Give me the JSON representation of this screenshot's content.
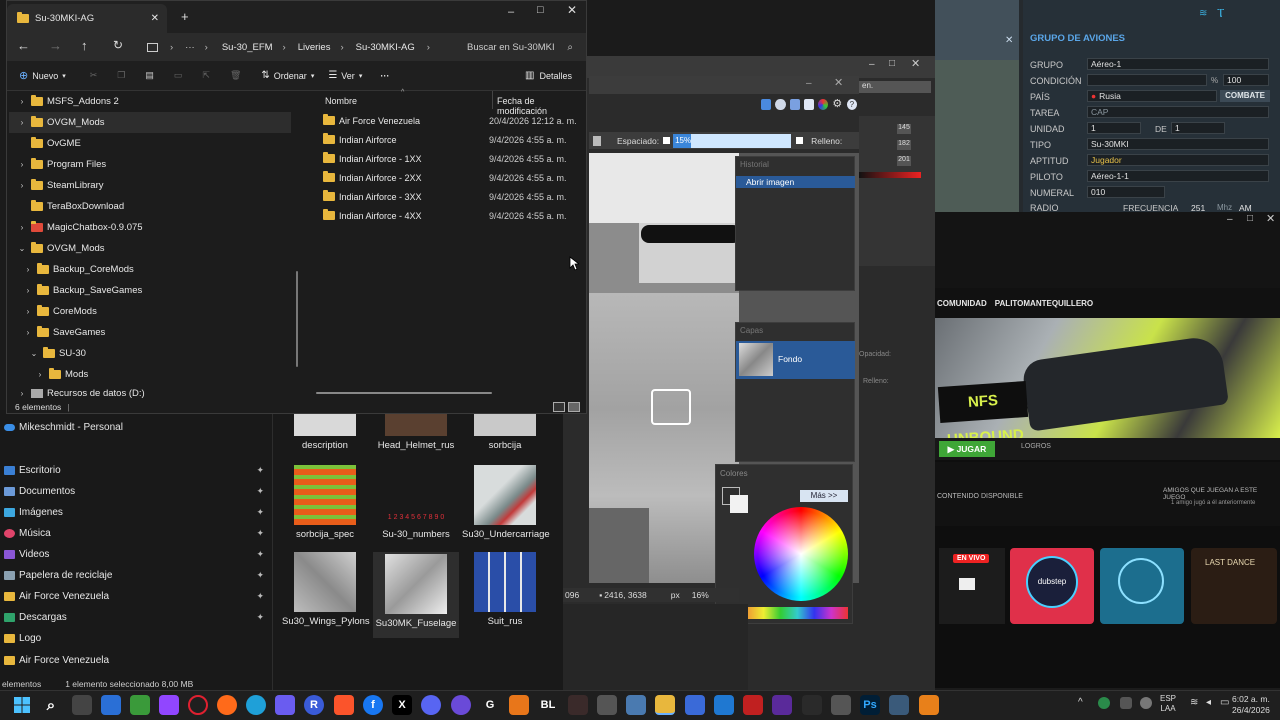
{
  "explorer": {
    "tab_title": "Su-30MKI-AG",
    "new_tab": "+",
    "breadcrumb": [
      "Su-30_EFM",
      "Liveries",
      "Su-30MKI-AG"
    ],
    "search_placeholder": "Buscar en Su-30MKI",
    "toolbar": {
      "new": "Nuevo",
      "sort": "Ordenar",
      "view": "Ver",
      "more": "···",
      "details": "Detalles"
    },
    "tree": [
      "MSFS_Addons 2",
      "OVGM_Mods",
      "OvGME",
      "Program Files",
      "SteamLibrary",
      "TeraBoxDownload",
      "MagicChatbox-0.9.075",
      "OVGM_Mods",
      "Backup_CoreMods",
      "Backup_SaveGames",
      "CoreMods",
      "SaveGames",
      "SU-30",
      "Mods",
      "Recursos de datos (D:)"
    ],
    "columns": {
      "name": "Nombre",
      "date": "Fecha de modificación"
    },
    "files": [
      {
        "name": "Air Force Venezuela",
        "date": "20/4/2026 12:12 a. m."
      },
      {
        "name": "Indian Airforce",
        "date": "9/4/2026 4:55 a. m."
      },
      {
        "name": "Indian Airforce - 1XX",
        "date": "9/4/2026 4:55 a. m."
      },
      {
        "name": "Indian Airforce - 2XX",
        "date": "9/4/2026 4:55 a. m."
      },
      {
        "name": "Indian Airforce - 3XX",
        "date": "9/4/2026 4:55 a. m."
      },
      {
        "name": "Indian Airforce - 4XX",
        "date": "9/4/2026 4:55 a. m."
      }
    ],
    "status": "6 elementos"
  },
  "bg_explorer": {
    "onedrive": "Mikeschmidt - Personal",
    "quick_access": [
      "Escritorio",
      "Documentos",
      "Imágenes",
      "Música",
      "Videos",
      "Papelera de reciclaje",
      "Air Force Venezuela",
      "Descargas",
      "Logo",
      "Air Force Venezuela"
    ],
    "thumbs": [
      "description",
      "Head_Helmet_rus",
      "sorbcija",
      "sorbcija_spec",
      "Su-30_numbers",
      "Su30_Undercarriage",
      "Su30_Wings_Pylons",
      "Su30MK_Fuselage",
      "Suit_rus"
    ],
    "numbers_text": "1 2 3 4 5 6 7 8 9 0",
    "status_left": "elementos",
    "status_sel": "1 elemento seleccionado  8,00 MB"
  },
  "ps": {
    "spacing_label": "Espaciado:",
    "spacing_value": "15%",
    "fill_label": "Relleno:",
    "history_title": "Historial",
    "history_item": "Abrir imagen",
    "layers_title": "Capas",
    "layer_name": "Fondo",
    "colors_title": "Colores",
    "more_btn": "Más >>",
    "coords": "2416, 3638",
    "unit": "px",
    "zoom": "16%",
    "left_num": "096",
    "rgb": [
      "145",
      "182",
      "201"
    ],
    "opacity_label": "Opacidad:",
    "fill2_label": "Relleno:",
    "mode_label": "en."
  },
  "editor": {
    "title": "GRUPO DE AVIONES",
    "grupo_label": "GRUPO",
    "grupo": "Aéreo-1",
    "condicion_label": "CONDICIÓN",
    "condicion_value": "100",
    "pais_label": "PAÍS",
    "pais": "Rusia",
    "combate": "COMBATE",
    "tarea_label": "TAREA",
    "tarea": "CAP",
    "unidad_label": "UNIDAD",
    "unidad": "1",
    "de": "DE",
    "de_value": "1",
    "tipo_label": "TIPO",
    "tipo": "Su-30MKI",
    "aptitud_label": "APTITUD",
    "aptitud": "Jugador",
    "piloto_label": "PILOTO",
    "piloto": "Aéreo-1-1",
    "numeral_label": "NUMERAL",
    "numeral": "010",
    "radio_label": "RADIO",
    "frecuencia_label": "FRECUENCIA",
    "frecuencia": "251",
    "mhz": "Mhz",
    "am": "AM"
  },
  "launcher": {
    "community": "COMUNIDAD",
    "user": "PALITOMANTEQUILLERO",
    "game_logo": "NFS UNBOUND",
    "play": "JUGAR",
    "logros": "LOGROS",
    "available": "CONTENIDO DISPONIBLE",
    "friends": "AMIGOS QUE JUEGAN A ESTE JUEGO",
    "friends_sub": "1 amigo jugó a él anteriormente",
    "live": "EN VIVO",
    "dubstep": "dubstep",
    "last_dance": "LAST DANCE"
  },
  "taskbar": {
    "lang": "ESP",
    "lang2": "LAA",
    "time": "6:02 a. m.",
    "date": "26/4/2026"
  },
  "colors": {
    "accent": "#0078d4",
    "folder": "#e8b73d",
    "editor_title": "#5aa6e8"
  }
}
